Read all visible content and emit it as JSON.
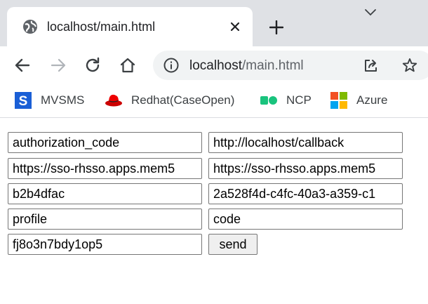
{
  "browser": {
    "tab": {
      "title": "localhost/main.html"
    },
    "address_bar": {
      "host": "localhost",
      "path": "/main.html"
    },
    "bookmarks": [
      {
        "label": "MVSMS",
        "icon": "mvsms-icon"
      },
      {
        "label": "Redhat(CaseOpen)",
        "icon": "redhat-icon"
      },
      {
        "label": "NCP",
        "icon": "ncp-icon"
      },
      {
        "label": "Azure",
        "icon": "microsoft-icon"
      }
    ]
  },
  "form": {
    "fields": [
      {
        "value": "authorization_code"
      },
      {
        "value": "http://localhost/callback"
      },
      {
        "value": "https://sso-rhsso.apps.mem5"
      },
      {
        "value": "https://sso-rhsso.apps.mem5"
      },
      {
        "value": "b2b4dfac"
      },
      {
        "value": "2a528f4d-c4fc-40a3-a359-c1"
      },
      {
        "value": "profile"
      },
      {
        "value": "code"
      },
      {
        "value": "fj8o3n7bdy1op5"
      }
    ],
    "send_label": "send"
  },
  "colors": {
    "tabstrip_bg": "#dfe1e5",
    "omnibox_bg": "#f1f3f4",
    "button_bg": "#efefef",
    "field_border": "#767676"
  }
}
